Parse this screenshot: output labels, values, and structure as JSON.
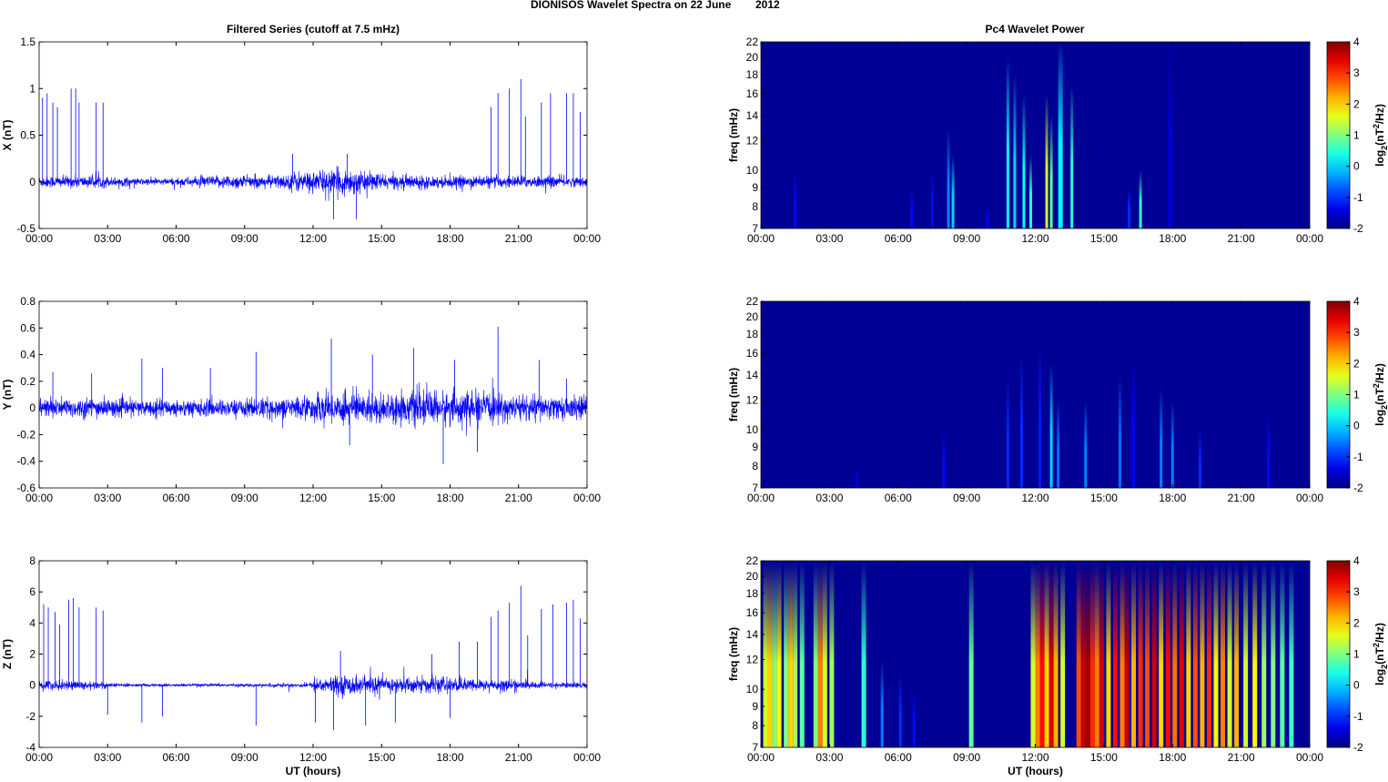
{
  "title": "DIONISOS Wavelet Spectra on 22 June",
  "year": "2012",
  "chart_data": [
    {
      "type": "line",
      "panel": "X",
      "title": "Filtered Series (cutoff at 7.5 mHz)",
      "ylabel": "X (nT)",
      "xlabel": "",
      "ylim": [
        -0.5,
        1.5
      ],
      "yticks": [
        "1.5",
        "1",
        "0.5",
        "0",
        "-0.5"
      ],
      "ytick_values": [
        1.5,
        1,
        0.5,
        0,
        -0.5
      ],
      "xlim_hours": [
        0,
        24
      ],
      "xticks": [
        "00:00",
        "03:00",
        "06:00",
        "09:00",
        "12:00",
        "15:00",
        "18:00",
        "21:00",
        "00:00"
      ],
      "noise_amplitude_by_hour": [
        0.05,
        0.05,
        0.05,
        0.04,
        0.03,
        0.03,
        0.04,
        0.05,
        0.06,
        0.05,
        0.06,
        0.09,
        0.1,
        0.11,
        0.08,
        0.06,
        0.06,
        0.05,
        0.05,
        0.05,
        0.05,
        0.05,
        0.05,
        0.04
      ],
      "spikes": [
        [
          0.15,
          0.9
        ],
        [
          0.35,
          0.95
        ],
        [
          0.6,
          0.85
        ],
        [
          0.8,
          0.8
        ],
        [
          1.4,
          1.0
        ],
        [
          1.6,
          1.0
        ],
        [
          1.75,
          0.85
        ],
        [
          2.5,
          0.85
        ],
        [
          2.8,
          0.85
        ],
        [
          11.1,
          0.3
        ],
        [
          13.5,
          0.3
        ],
        [
          13.9,
          -0.4
        ],
        [
          12.9,
          -0.4
        ],
        [
          19.8,
          0.8
        ],
        [
          20.1,
          0.95
        ],
        [
          20.6,
          1.0
        ],
        [
          21.1,
          1.1
        ],
        [
          21.3,
          0.7
        ],
        [
          22.0,
          0.85
        ],
        [
          22.4,
          0.95
        ],
        [
          23.1,
          0.95
        ],
        [
          23.4,
          0.95
        ],
        [
          23.7,
          0.75
        ]
      ]
    },
    {
      "type": "line",
      "panel": "Y",
      "ylabel": "Y (nT)",
      "xlabel": "",
      "ylim": [
        -0.6,
        0.8
      ],
      "yticks": [
        "0.8",
        "0.6",
        "0.4",
        "0.2",
        "0",
        "-0.2",
        "-0.4",
        "-0.6"
      ],
      "ytick_values": [
        0.8,
        0.6,
        0.4,
        0.2,
        0,
        -0.2,
        -0.4,
        -0.6
      ],
      "xlim_hours": [
        0,
        24
      ],
      "xticks": [
        "00:00",
        "03:00",
        "06:00",
        "09:00",
        "12:00",
        "15:00",
        "18:00",
        "21:00",
        "00:00"
      ],
      "noise_amplitude_by_hour": [
        0.06,
        0.06,
        0.06,
        0.05,
        0.05,
        0.05,
        0.05,
        0.05,
        0.05,
        0.06,
        0.06,
        0.07,
        0.09,
        0.1,
        0.09,
        0.09,
        0.1,
        0.1,
        0.1,
        0.09,
        0.08,
        0.08,
        0.07,
        0.07
      ],
      "spikes": [
        [
          0.6,
          0.27
        ],
        [
          2.3,
          0.26
        ],
        [
          4.5,
          0.37
        ],
        [
          5.4,
          0.3
        ],
        [
          7.5,
          0.3
        ],
        [
          9.5,
          0.42
        ],
        [
          12.8,
          0.52
        ],
        [
          13.6,
          -0.28
        ],
        [
          14.6,
          0.4
        ],
        [
          16.4,
          0.45
        ],
        [
          17.7,
          -0.42
        ],
        [
          18.2,
          0.36
        ],
        [
          19.2,
          -0.33
        ],
        [
          20.1,
          0.61
        ],
        [
          21.9,
          0.36
        ],
        [
          23.1,
          0.22
        ]
      ]
    },
    {
      "type": "line",
      "panel": "Z",
      "ylabel": "Z (nT)",
      "xlabel": "UT (hours)",
      "ylim": [
        -4,
        8
      ],
      "yticks": [
        "8",
        "6",
        "4",
        "2",
        "0",
        "-2",
        "-4"
      ],
      "ytick_values": [
        8,
        6,
        4,
        2,
        0,
        -2,
        -4
      ],
      "xlim_hours": [
        0,
        24
      ],
      "xticks": [
        "00:00",
        "03:00",
        "06:00",
        "09:00",
        "12:00",
        "15:00",
        "18:00",
        "21:00",
        "00:00"
      ],
      "noise_amplitude_by_hour": [
        0.25,
        0.25,
        0.2,
        0.1,
        0.08,
        0.08,
        0.08,
        0.08,
        0.08,
        0.08,
        0.1,
        0.12,
        0.4,
        0.5,
        0.45,
        0.4,
        0.4,
        0.4,
        0.35,
        0.3,
        0.3,
        0.2,
        0.15,
        0.15
      ],
      "spikes": [
        [
          0.2,
          5.2
        ],
        [
          0.4,
          5.0
        ],
        [
          0.7,
          4.7
        ],
        [
          0.9,
          3.9
        ],
        [
          1.3,
          5.5
        ],
        [
          1.5,
          5.6
        ],
        [
          1.75,
          5.0
        ],
        [
          2.5,
          5.0
        ],
        [
          2.8,
          4.8
        ],
        [
          3.0,
          -1.9
        ],
        [
          4.5,
          -2.4
        ],
        [
          5.4,
          -2.0
        ],
        [
          9.5,
          -2.6
        ],
        [
          12.1,
          -2.4
        ],
        [
          12.9,
          -2.9
        ],
        [
          13.2,
          2.2
        ],
        [
          14.3,
          -2.6
        ],
        [
          15.6,
          -2.4
        ],
        [
          17.2,
          2.0
        ],
        [
          18.0,
          -2.1
        ],
        [
          18.4,
          2.8
        ],
        [
          19.2,
          2.8
        ],
        [
          19.8,
          4.4
        ],
        [
          20.1,
          4.8
        ],
        [
          20.6,
          5.3
        ],
        [
          21.1,
          6.4
        ],
        [
          21.4,
          3.2
        ],
        [
          22.0,
          4.9
        ],
        [
          22.5,
          5.2
        ],
        [
          23.1,
          5.3
        ],
        [
          23.4,
          5.5
        ],
        [
          23.7,
          4.3
        ]
      ]
    },
    {
      "type": "heatmap",
      "panel": "X",
      "title": "Pc4 Wavelet Power",
      "ylabel": "freq (mHz)",
      "xlabel": "",
      "ylim_mHz": [
        7,
        22
      ],
      "yscale": "log",
      "yticks": [
        "22",
        "20",
        "18",
        "16",
        "14",
        "12",
        "10",
        "9",
        "8",
        "7"
      ],
      "ytick_values": [
        22,
        20,
        18,
        16,
        14,
        12,
        10,
        9,
        8,
        7
      ],
      "xticks": [
        "00:00",
        "03:00",
        "06:00",
        "09:00",
        "12:00",
        "15:00",
        "18:00",
        "21:00",
        "00:00"
      ],
      "clim": [
        -2,
        4
      ],
      "cticks": [
        "4",
        "3",
        "2",
        "1",
        "0",
        "-1",
        "-2"
      ],
      "ctick_values": [
        4,
        3,
        2,
        1,
        0,
        -1,
        -2
      ],
      "bursts_hour_fmax_power": [
        [
          1.5,
          10,
          -1.2
        ],
        [
          6.6,
          9,
          -1.2
        ],
        [
          7.5,
          10,
          -1.2
        ],
        [
          8.2,
          13,
          -0.5
        ],
        [
          8.4,
          11,
          0
        ],
        [
          9.9,
          8,
          -1.3
        ],
        [
          10.8,
          20,
          0.3
        ],
        [
          11.1,
          18,
          0
        ],
        [
          11.5,
          16,
          0.3
        ],
        [
          11.8,
          11,
          0.5
        ],
        [
          12.5,
          16,
          1.5
        ],
        [
          12.7,
          14,
          0.8
        ],
        [
          13.1,
          22,
          0.2
        ],
        [
          13.6,
          17,
          0.5
        ],
        [
          16.1,
          9,
          -1
        ],
        [
          16.6,
          10,
          0.5
        ],
        [
          17.9,
          22,
          -1.5
        ]
      ]
    },
    {
      "type": "heatmap",
      "panel": "Y",
      "ylabel": "freq (mHz)",
      "xlabel": "",
      "ylim_mHz": [
        7,
        22
      ],
      "yscale": "log",
      "yticks": [
        "22",
        "20",
        "18",
        "16",
        "14",
        "12",
        "10",
        "9",
        "8",
        "7"
      ],
      "ytick_values": [
        22,
        20,
        18,
        16,
        14,
        12,
        10,
        9,
        8,
        7
      ],
      "xticks": [
        "00:00",
        "03:00",
        "06:00",
        "09:00",
        "12:00",
        "15:00",
        "18:00",
        "21:00",
        "00:00"
      ],
      "clim": [
        -2,
        4
      ],
      "cticks": [
        "4",
        "3",
        "2",
        "1",
        "0",
        "-1",
        "-2"
      ],
      "ctick_values": [
        4,
        3,
        2,
        1,
        0,
        -1,
        -2
      ],
      "bursts_hour_fmax_power": [
        [
          4.2,
          8,
          -1.5
        ],
        [
          8,
          10,
          -1.2
        ],
        [
          10.8,
          14,
          -1
        ],
        [
          11.4,
          16,
          -1
        ],
        [
          12.2,
          17,
          -1.1
        ],
        [
          12.7,
          15,
          0
        ],
        [
          13,
          12,
          -0.6
        ],
        [
          14.2,
          12,
          -0.5
        ],
        [
          15.7,
          14,
          -0.6
        ],
        [
          16.3,
          16,
          -1.3
        ],
        [
          17.5,
          13,
          -0.5
        ],
        [
          18,
          12,
          -0.5
        ],
        [
          19.2,
          10,
          -1
        ],
        [
          22.2,
          11,
          -1.2
        ]
      ]
    },
    {
      "type": "heatmap",
      "panel": "Z",
      "ylabel": "freq (mHz)",
      "xlabel": "UT (hours)",
      "ylim_mHz": [
        7,
        22
      ],
      "yscale": "log",
      "yticks": [
        "22",
        "20",
        "18",
        "16",
        "14",
        "12",
        "10",
        "9",
        "8",
        "7"
      ],
      "ytick_values": [
        22,
        20,
        18,
        16,
        14,
        12,
        10,
        9,
        8,
        7
      ],
      "xticks": [
        "00:00",
        "03:00",
        "06:00",
        "09:00",
        "12:00",
        "15:00",
        "18:00",
        "21:00",
        "00:00"
      ],
      "clim": [
        -2,
        4
      ],
      "cticks": [
        "4",
        "3",
        "2",
        "1",
        "0",
        "-1",
        "-2"
      ],
      "ctick_values": [
        4,
        3,
        2,
        1,
        0,
        -1,
        -2
      ],
      "bursts_hour_fmax_power": [
        [
          0.2,
          22,
          1.5
        ],
        [
          0.4,
          22,
          2
        ],
        [
          0.6,
          22,
          1
        ],
        [
          0.8,
          22,
          1.8
        ],
        [
          1.1,
          22,
          1
        ],
        [
          1.3,
          22,
          2
        ],
        [
          1.5,
          22,
          1.2
        ],
        [
          1.8,
          22,
          0.8
        ],
        [
          2.4,
          22,
          1
        ],
        [
          2.6,
          22,
          2.5
        ],
        [
          2.8,
          22,
          1.5
        ],
        [
          3.1,
          22,
          1.2
        ],
        [
          4.5,
          22,
          0.5
        ],
        [
          5.3,
          12,
          -0.5
        ],
        [
          6.1,
          11,
          -1
        ],
        [
          6.7,
          10,
          -1.2
        ],
        [
          9.2,
          22,
          0.8
        ],
        [
          11.9,
          22,
          1.5
        ],
        [
          12.1,
          22,
          2.5
        ],
        [
          12.3,
          22,
          3.2
        ],
        [
          12.5,
          22,
          2
        ],
        [
          12.7,
          22,
          3.5
        ],
        [
          12.9,
          22,
          2.2
        ],
        [
          13.2,
          22,
          1.5
        ],
        [
          13.9,
          22,
          2.8
        ],
        [
          14.1,
          22,
          3.6
        ],
        [
          14.3,
          22,
          3.8
        ],
        [
          14.5,
          22,
          3
        ],
        [
          14.7,
          22,
          2.5
        ],
        [
          14.9,
          22,
          3.5
        ],
        [
          15.2,
          22,
          2
        ],
        [
          15.5,
          22,
          3.2
        ],
        [
          15.8,
          22,
          2.5
        ],
        [
          16.0,
          22,
          3.6
        ],
        [
          16.3,
          22,
          2.2
        ],
        [
          16.6,
          22,
          3
        ],
        [
          16.9,
          22,
          2.8
        ],
        [
          17.2,
          22,
          3.5
        ],
        [
          17.5,
          22,
          2
        ],
        [
          17.8,
          22,
          3.2
        ],
        [
          18.1,
          22,
          2.6
        ],
        [
          18.4,
          22,
          3.4
        ],
        [
          18.7,
          22,
          2
        ],
        [
          19.0,
          22,
          2.8
        ],
        [
          19.3,
          22,
          2.2
        ],
        [
          19.6,
          22,
          3
        ],
        [
          19.9,
          22,
          1.8
        ],
        [
          20.2,
          22,
          2.5
        ],
        [
          20.5,
          22,
          1.5
        ],
        [
          20.8,
          22,
          2.2
        ],
        [
          21.2,
          22,
          1.5
        ],
        [
          21.6,
          22,
          1.8
        ],
        [
          22.0,
          22,
          1.2
        ],
        [
          22.4,
          22,
          1
        ],
        [
          22.8,
          22,
          0.8
        ],
        [
          23.2,
          22,
          0.6
        ]
      ]
    }
  ],
  "colorbar_label": {
    "base": "log",
    "sub": "2",
    "pre": "(nT",
    "sup": "2",
    "post": "/Hz)"
  },
  "colors": {
    "series": "#0000ff",
    "background_low": "#00008f"
  }
}
